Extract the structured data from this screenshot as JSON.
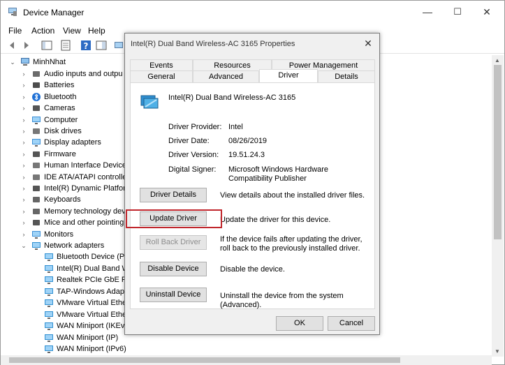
{
  "window": {
    "title": "Device Manager",
    "controls": {
      "minimize": "—",
      "maximize": "☐",
      "close": "✕"
    }
  },
  "menu": [
    "File",
    "Action",
    "View",
    "Help"
  ],
  "tree": {
    "root": "MinhNhat",
    "categories": [
      {
        "label": "Audio inputs and outpu",
        "icon": "speaker-icon"
      },
      {
        "label": "Batteries",
        "icon": "battery-icon"
      },
      {
        "label": "Bluetooth",
        "icon": "bluetooth-icon"
      },
      {
        "label": "Cameras",
        "icon": "camera-icon"
      },
      {
        "label": "Computer",
        "icon": "monitor-icon"
      },
      {
        "label": "Disk drives",
        "icon": "disk-icon"
      },
      {
        "label": "Display adapters",
        "icon": "monitor-icon"
      },
      {
        "label": "Firmware",
        "icon": "chip-icon"
      },
      {
        "label": "Human Interface Devices",
        "icon": "hid-icon"
      },
      {
        "label": "IDE ATA/ATAPI controllers",
        "icon": "controller-icon"
      },
      {
        "label": "Intel(R) Dynamic Platforn",
        "icon": "chip-icon"
      },
      {
        "label": "Keyboards",
        "icon": "keyboard-icon"
      },
      {
        "label": "Memory technology dev",
        "icon": "memory-icon"
      },
      {
        "label": "Mice and other pointing",
        "icon": "mouse-icon"
      },
      {
        "label": "Monitors",
        "icon": "monitor-icon"
      },
      {
        "label": "Network adapters",
        "icon": "network-icon"
      }
    ],
    "network_children": [
      "Bluetooth Device (Pe",
      "Intel(R) Dual Band W",
      "Realtek PCIe GbE Fam",
      "TAP-Windows Adapte",
      "VMware Virtual Ether",
      "VMware Virtual Ether",
      "WAN Miniport (IKEv2",
      "WAN Miniport (IP)",
      "WAN Miniport (IPv6)"
    ]
  },
  "dialog": {
    "title": "Intel(R) Dual Band Wireless-AC 3165 Properties",
    "tabs_top": [
      "Events",
      "Resources",
      "Power Management"
    ],
    "tabs_bottom": [
      "General",
      "Advanced",
      "Driver",
      "Details"
    ],
    "selected_tab": "Driver",
    "device_name": "Intel(R) Dual Band Wireless-AC 3165",
    "fields": [
      {
        "label": "Driver Provider:",
        "value": "Intel"
      },
      {
        "label": "Driver Date:",
        "value": "08/26/2019"
      },
      {
        "label": "Driver Version:",
        "value": "19.51.24.3"
      },
      {
        "label": "Digital Signer:",
        "value": "Microsoft Windows Hardware Compatibility Publisher"
      }
    ],
    "actions": [
      {
        "button": "Driver Details",
        "desc": "View details about the installed driver files.",
        "enabled": true
      },
      {
        "button": "Update Driver",
        "desc": "Update the driver for this device.",
        "enabled": true
      },
      {
        "button": "Roll Back Driver",
        "desc": "If the device fails after updating the driver, roll back to the previously installed driver.",
        "enabled": false
      },
      {
        "button": "Disable Device",
        "desc": "Disable the device.",
        "enabled": true
      },
      {
        "button": "Uninstall Device",
        "desc": "Uninstall the device from the system (Advanced).",
        "enabled": true
      }
    ],
    "ok": "OK",
    "cancel": "Cancel",
    "highlight_color": "#c0262c"
  }
}
